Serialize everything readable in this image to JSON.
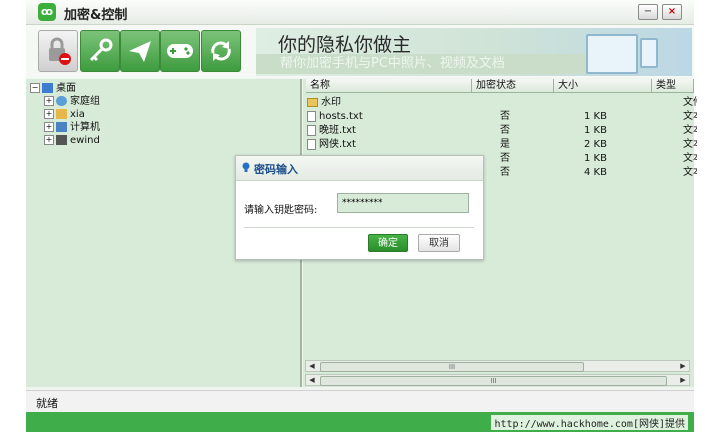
{
  "window": {
    "title": "加密&控制",
    "app_icon_glyph": "ꝏ",
    "min_label": "−",
    "close_label": "×"
  },
  "toolbar": {
    "buttons": [
      {
        "icon": "lock-prohibit-icon"
      },
      {
        "icon": "key-icon"
      },
      {
        "icon": "paper-plane-icon"
      },
      {
        "icon": "gamepad-icon"
      },
      {
        "icon": "sync-arrows-icon"
      }
    ],
    "banner_title": "你的隐私你做主",
    "banner_subtitle": "帮你加密手机与PC中照片、视频及文档"
  },
  "tree": {
    "root": "桌面",
    "children": [
      "家庭组",
      "xia",
      "计算机",
      "ewind"
    ]
  },
  "file_list": {
    "columns": [
      "名称",
      "加密状态",
      "大小",
      "类型"
    ],
    "rows": [
      {
        "name": "水印",
        "status": "",
        "size": "",
        "type": "文件夹"
      },
      {
        "name": "hosts.txt",
        "status": "否",
        "size": "1 KB",
        "type": "文本文档"
      },
      {
        "name": "晚班.txt",
        "status": "否",
        "size": "1 KB",
        "type": "文本文档"
      },
      {
        "name": "网侠.txt",
        "status": "是",
        "size": "2 KB",
        "type": "文本文档"
      },
      {
        "name": "",
        "status": "否",
        "size": "1 KB",
        "type": "文本文档"
      },
      {
        "name": "",
        "status": "否",
        "size": "4 KB",
        "type": "文本文档"
      }
    ],
    "scroll_thumb_glyph": "III"
  },
  "dialog": {
    "title": "密码输入",
    "label": "请输入钥匙密码:",
    "password_value": "*********",
    "ok_label": "确定",
    "cancel_label": "取消"
  },
  "status_bar": {
    "text": "就绪"
  },
  "footer": {
    "text": "http://www.hackhome.com[网侠]提供"
  },
  "colors": {
    "accent_green": "#3fae4a",
    "pane_bg": "#d8ead8",
    "dialog_title": "#1f4f8a"
  }
}
